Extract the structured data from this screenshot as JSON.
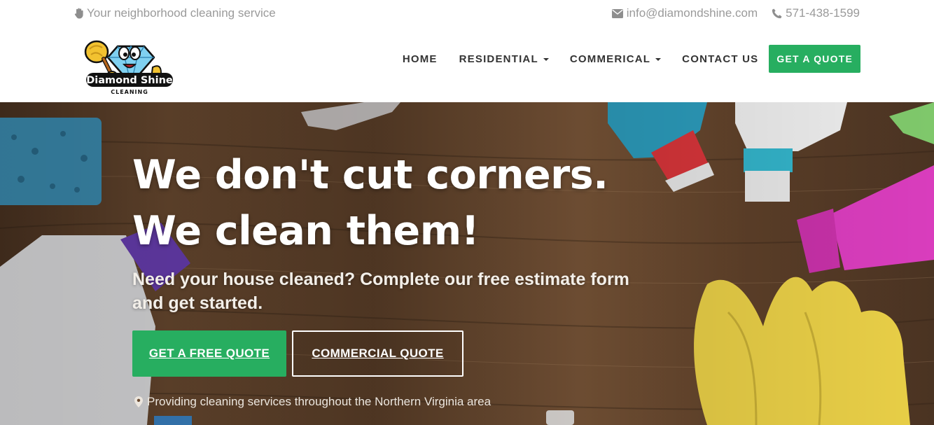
{
  "topbar": {
    "tagline": "Your neighborhood cleaning service",
    "tagline_icon": "hand-icon",
    "email": "info@diamondshine.com",
    "email_icon": "envelope-icon",
    "phone": "571-438-1599",
    "phone_icon": "phone-icon"
  },
  "logo": {
    "line1": "Diamond Shine",
    "line2": "CLEANING"
  },
  "nav": {
    "home": "HOME",
    "residential": "RESIDENTIAL",
    "commercial": "COMMERICAL",
    "contact": "CONTACT US",
    "quote": "GET A QUOTE"
  },
  "hero": {
    "headline_line1": "We don't cut corners.",
    "headline_line2": "We clean them!",
    "subline": "Need your house cleaned? Complete our free estimate form and get started.",
    "free_quote_button": "GET A FREE QUOTE",
    "commercial_quote_button": "COMMERCIAL QUOTE",
    "area_note": "Providing cleaning services throughout the Northern Virginia area",
    "area_icon": "map-marker-icon"
  },
  "colors": {
    "accent_green": "#27ae60",
    "muted_text": "#9a9a9a",
    "nav_text": "#333333"
  }
}
